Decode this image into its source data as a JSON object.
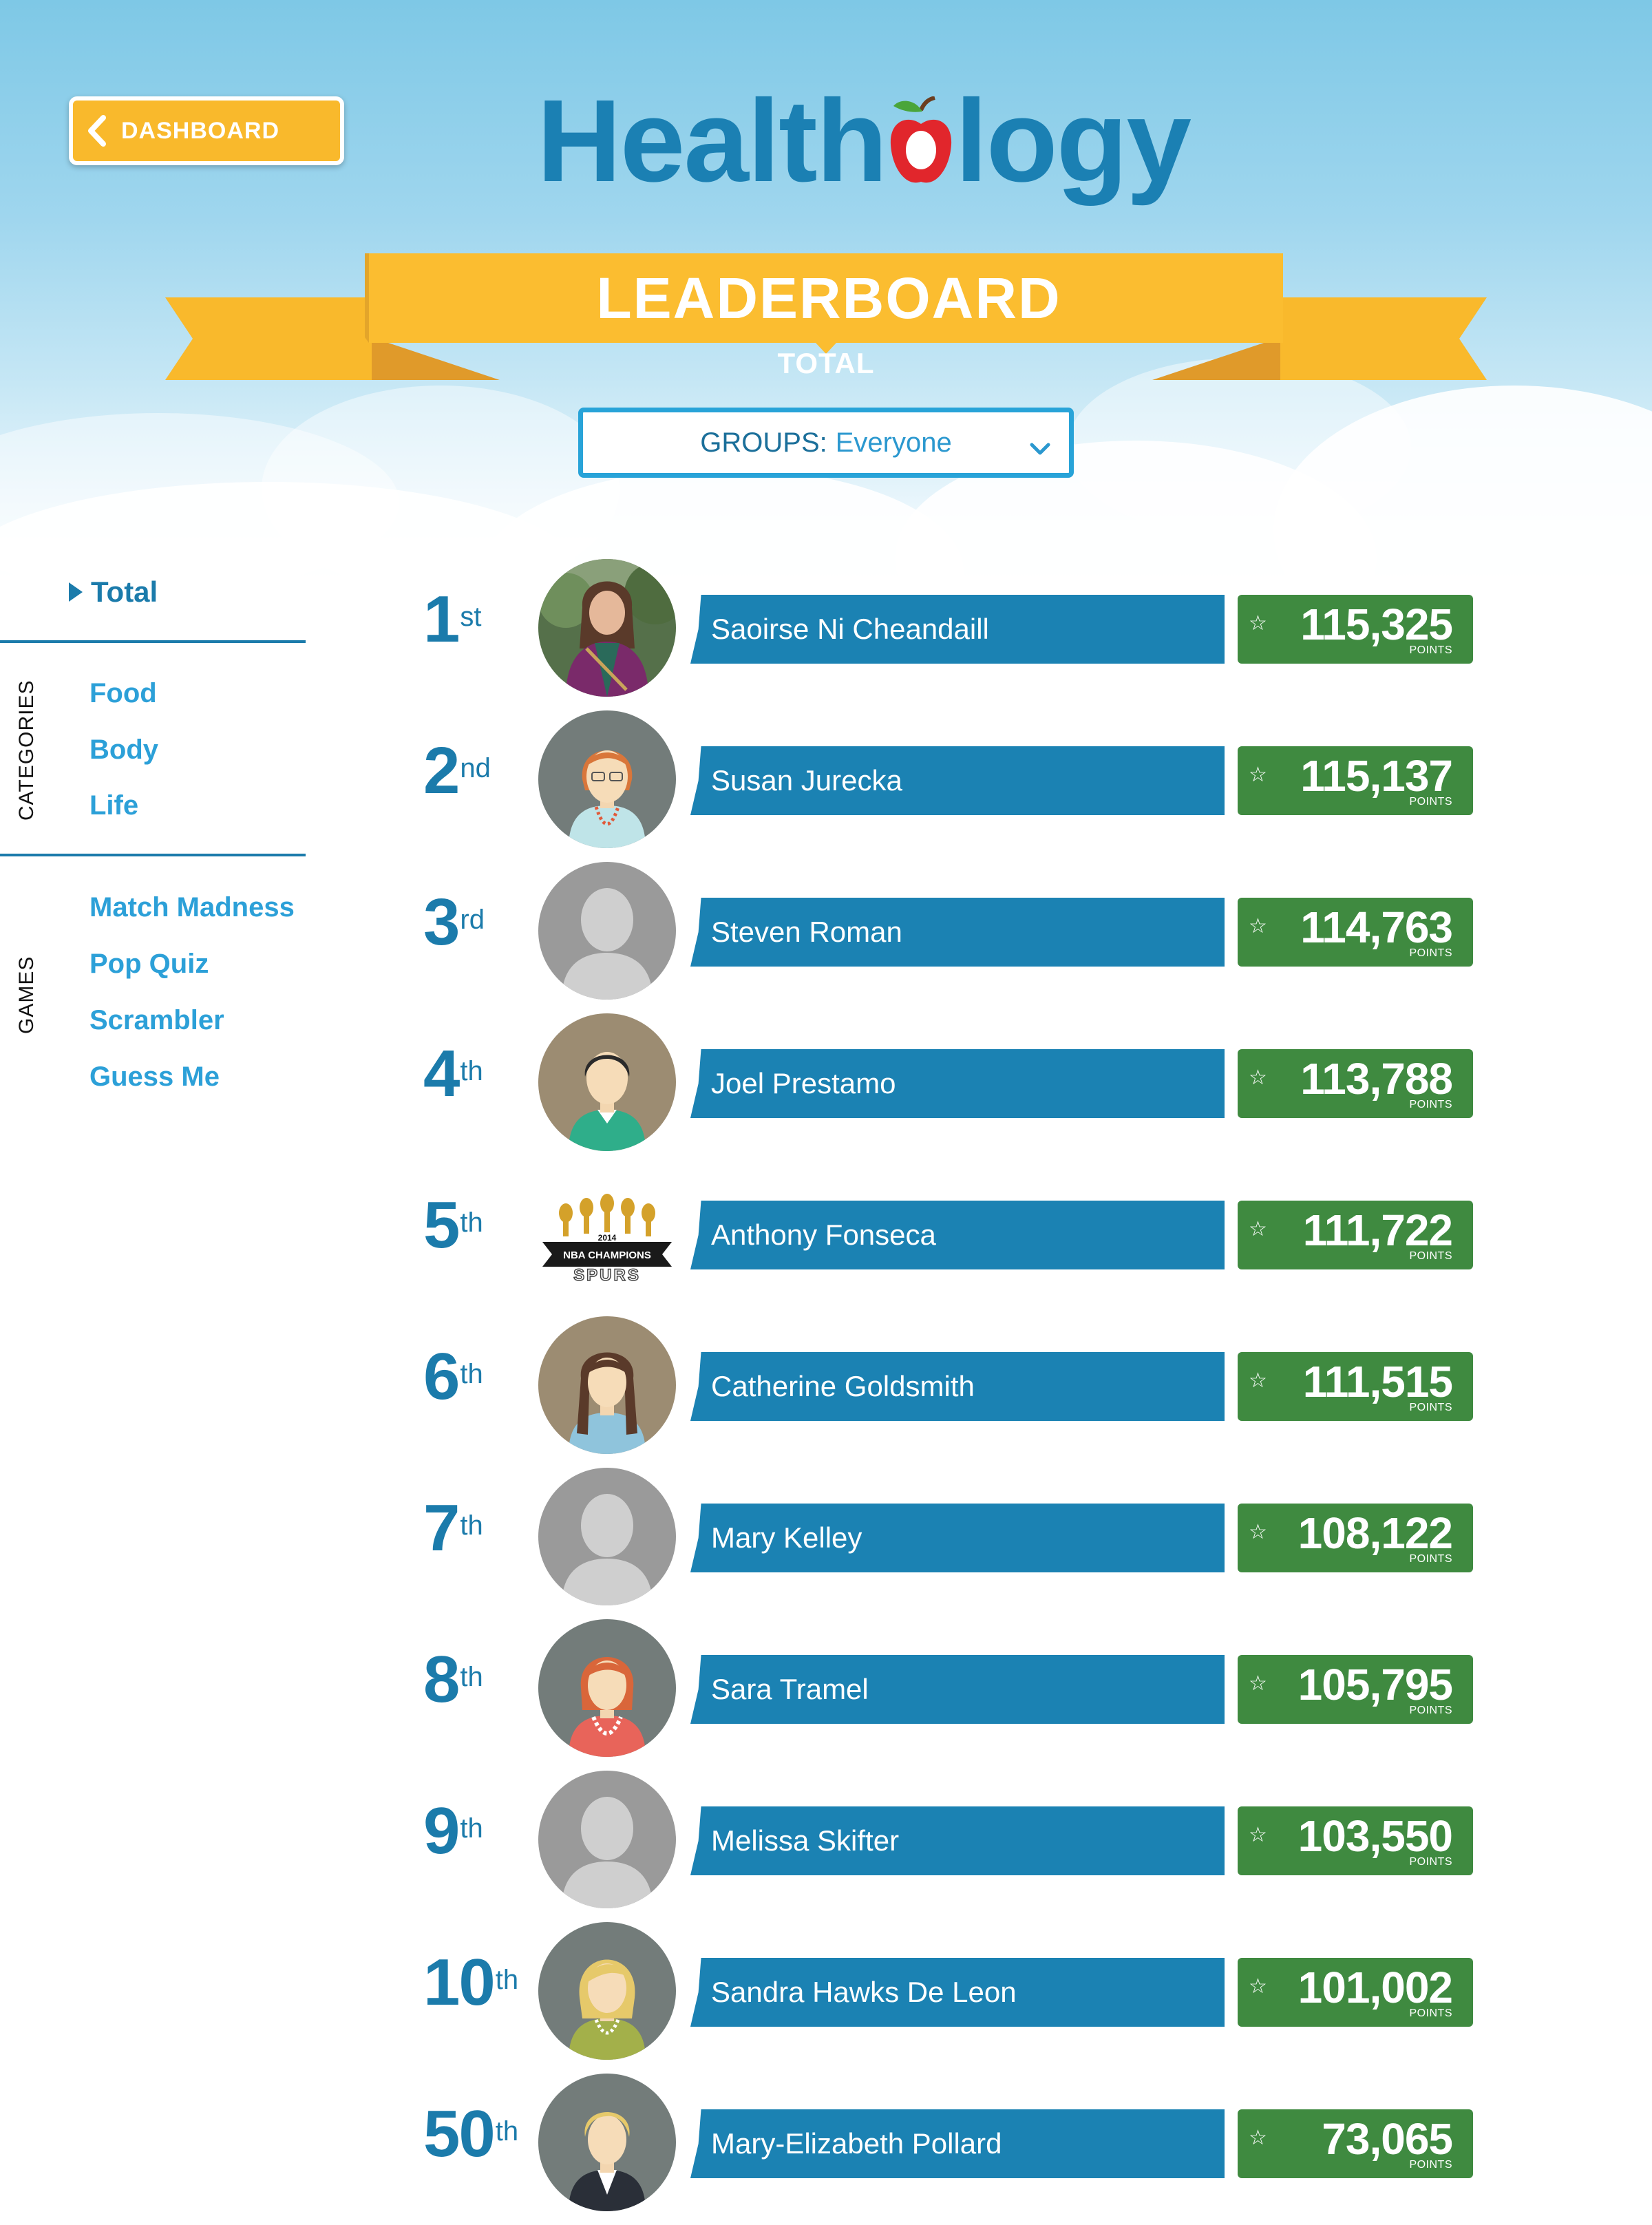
{
  "header": {
    "dashboard_label": "DASHBOARD",
    "logo_left": "Health",
    "logo_right": "logy",
    "title": "LEADERBOARD",
    "subtitle": "TOTAL",
    "groups_label": "GROUPS:",
    "groups_value": "Everyone"
  },
  "sidebar": {
    "total_label": "Total",
    "categories_label": "CATEGORIES",
    "categories": [
      "Food",
      "Body",
      "Life"
    ],
    "games_label": "GAMES",
    "games": [
      "Match Madness",
      "Pop Quiz",
      "Scrambler",
      "Guess Me"
    ]
  },
  "points_label": "POINTS",
  "colors": {
    "brand_blue": "#1b80b3",
    "name_bar": "#1b82b3",
    "score_green": "#3f8a40",
    "ribbon_yellow": "#f9b92c",
    "ribbon_dark": "#e09a2a"
  },
  "leaderboard": [
    {
      "rank": "1",
      "suffix": "st",
      "name": "Saoirse Ni Cheandaill",
      "points": "115,325",
      "avatar": "photo-woman"
    },
    {
      "rank": "2",
      "suffix": "nd",
      "name": "Susan Jurecka",
      "points": "115,137",
      "avatar": "woman-glasses"
    },
    {
      "rank": "3",
      "suffix": "rd",
      "name": "Steven Roman",
      "points": "114,763",
      "avatar": "default-silhouette"
    },
    {
      "rank": "4",
      "suffix": "th",
      "name": "Joel Prestamo",
      "points": "113,788",
      "avatar": "man-dark-hair"
    },
    {
      "rank": "5",
      "suffix": "th",
      "name": "Anthony Fonseca",
      "points": "111,722",
      "avatar": "spurs-logo"
    },
    {
      "rank": "6",
      "suffix": "th",
      "name": "Catherine Goldsmith",
      "points": "111,515",
      "avatar": "woman-pigtails"
    },
    {
      "rank": "7",
      "suffix": "th",
      "name": "Mary Kelley",
      "points": "108,122",
      "avatar": "default-silhouette"
    },
    {
      "rank": "8",
      "suffix": "th",
      "name": "Sara Tramel",
      "points": "105,795",
      "avatar": "woman-red-hair"
    },
    {
      "rank": "9",
      "suffix": "th",
      "name": "Melissa Skifter",
      "points": "103,550",
      "avatar": "default-silhouette"
    },
    {
      "rank": "10",
      "suffix": "th",
      "name": "Sandra Hawks De Leon",
      "points": "101,002",
      "avatar": "woman-blonde"
    },
    {
      "rank": "50",
      "suffix": "th",
      "name": "Mary-Elizabeth Pollard",
      "points": "73,065",
      "avatar": "woman-blonde-suit"
    }
  ],
  "spurs_logo_text": [
    "2014",
    "NBA CHAMPIONS",
    "SPURS"
  ]
}
